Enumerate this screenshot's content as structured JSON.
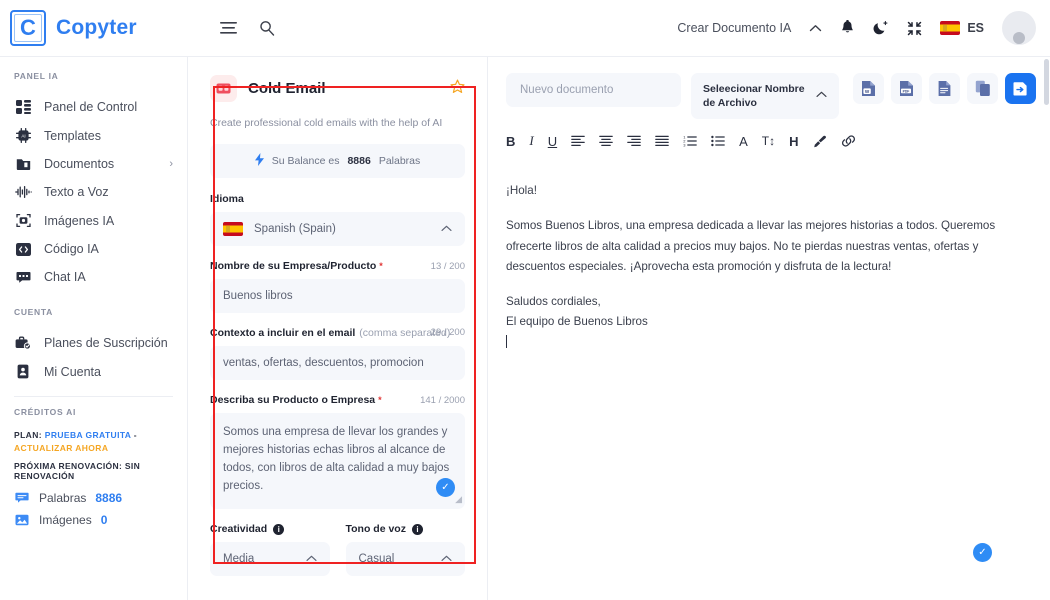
{
  "brand": {
    "mark": "C",
    "name": "Copyter"
  },
  "topbar": {
    "menu_icon": "menu-icon",
    "search_icon": "search-icon",
    "create_doc_label": "Crear Documento IA",
    "chevron_icon": "chevron-up-icon",
    "bell_icon": "bell-icon",
    "dark_mode_icon": "moon-icon",
    "fullscreen_icon": "collapse-icon",
    "language": "ES",
    "avatar": "user-avatar"
  },
  "sidebar": {
    "section_panel": "PANEL IA",
    "items": [
      {
        "label": "Panel de Control",
        "icon": "dashboard-icon",
        "arrow": ""
      },
      {
        "label": "Templates",
        "icon": "chip-ai-icon",
        "arrow": ""
      },
      {
        "label": "Documentos",
        "icon": "folder-icon",
        "arrow": "›"
      },
      {
        "label": "Texto a Voz",
        "icon": "waveform-icon",
        "arrow": ""
      },
      {
        "label": "Imágenes IA",
        "icon": "camera-frame-icon",
        "arrow": ""
      },
      {
        "label": "Código IA",
        "icon": "code-icon",
        "arrow": ""
      },
      {
        "label": "Chat IA",
        "icon": "chat-icon",
        "arrow": ""
      }
    ],
    "section_account": "CUENTA",
    "account_items": [
      {
        "label": "Planes de Suscripción",
        "icon": "briefcase-check-icon"
      },
      {
        "label": "Mi Cuenta",
        "icon": "id-card-icon"
      }
    ],
    "section_credits": "CRÉDITOS AI",
    "plan_prefix": "PLAN:",
    "plan_name": "PRUEBA GRATUITA",
    "plan_sep": "-",
    "plan_upgrade": "ACTUALIZAR AHORA",
    "renewal": "PRÓXIMA RENOVACIÓN: SIN RENOVACIÓN",
    "credits": [
      {
        "label": "Palabras",
        "value": "8886",
        "icon": "words-icon"
      },
      {
        "label": "Imágenes",
        "value": "0",
        "icon": "image-icon"
      }
    ]
  },
  "form": {
    "template_icon": "email-card-icon",
    "title": "Cold Email",
    "star_icon": "star-outline-icon",
    "description": "Create professional cold emails with the help of AI",
    "balance_icon": "bolt-icon",
    "balance_prefix": "Su Balance es",
    "balance_value": "8886",
    "balance_suffix": "Palabras",
    "language_label": "Idioma",
    "language_value": "Spanish (Spain)",
    "language_flag": "spain-flag-icon",
    "language_chevron": "chevron-up-icon",
    "company_label": "Nombre de su Empresa/Producto",
    "company_required": "*",
    "company_count": "13 / 200",
    "company_value": "Buenos libros",
    "context_label": "Contexto a incluir en el email",
    "context_hint": "(comma separated)",
    "context_count": "29 / 200",
    "context_value": "ventas, ofertas, descuentos, promocion",
    "describe_label": "Describa su Producto o Empresa",
    "describe_required": "*",
    "describe_count": "141 / 2000",
    "describe_value": "Somos una empresa de llevar los grandes y mejores historias echas libros al alcance de todos, con libros de alta calidad a muy bajos precios.",
    "describe_check_icon": "check-circle-icon",
    "creativity_label": "Creatividad",
    "creativity_info": "i",
    "creativity_value": "Media",
    "tone_label": "Tono de voz",
    "tone_info": "i",
    "tone_value": "Casual",
    "dropdown_chevron": "chevron-up-icon"
  },
  "editor": {
    "doc_name_placeholder": "Nuevo documento",
    "file_select_label": "Seleecionar Nombre de Archivo",
    "file_select_chevron": "chevron-up-icon",
    "export_buttons": [
      {
        "name": "export-word-button",
        "label": "W"
      },
      {
        "name": "export-pdf-button",
        "label": "PDF"
      },
      {
        "name": "export-text-button",
        "label": ""
      },
      {
        "name": "copy-button",
        "label": ""
      },
      {
        "name": "save-document-button",
        "label": ""
      }
    ],
    "format_buttons": [
      {
        "name": "bold-button",
        "glyph": "B"
      },
      {
        "name": "italic-button",
        "glyph": "I"
      },
      {
        "name": "underline-button",
        "glyph": "U"
      },
      {
        "name": "align-left-button",
        "glyph": "align-left-icon"
      },
      {
        "name": "align-center-button",
        "glyph": "align-center-icon"
      },
      {
        "name": "align-right-button",
        "glyph": "align-right-icon"
      },
      {
        "name": "align-justify-button",
        "glyph": "align-justify-icon"
      },
      {
        "name": "ordered-list-button",
        "glyph": "ordered-list-icon"
      },
      {
        "name": "bullet-list-button",
        "glyph": "bullet-list-icon"
      },
      {
        "name": "font-color-button",
        "glyph": "A"
      },
      {
        "name": "font-size-button",
        "glyph": "T↕"
      },
      {
        "name": "heading-button",
        "glyph": "H"
      },
      {
        "name": "highlight-button",
        "glyph": "brush-icon"
      },
      {
        "name": "link-button",
        "glyph": "link-icon"
      }
    ],
    "content": {
      "greeting": "¡Hola!",
      "paragraph": "Somos Buenos Libros, una empresa dedicada a llevar las mejores historias a todos. Queremos ofrecerte libros de alta calidad a precios muy bajos. No te pierdas nuestras ventas, ofertas y descuentos especiales. ¡Aprovecha esta promoción y disfruta de la lectura!",
      "closing": "Saludos cordiales,",
      "signature": "El equipo de Buenos Libros"
    },
    "status_check_icon": "check-circle-icon"
  },
  "annotation": {
    "highlight_color": "#ef2222"
  },
  "colors": {
    "brand": "#2f7ef0",
    "accent_blue": "#1a73f0",
    "warning": "#f5a623",
    "required": "#e03434"
  }
}
